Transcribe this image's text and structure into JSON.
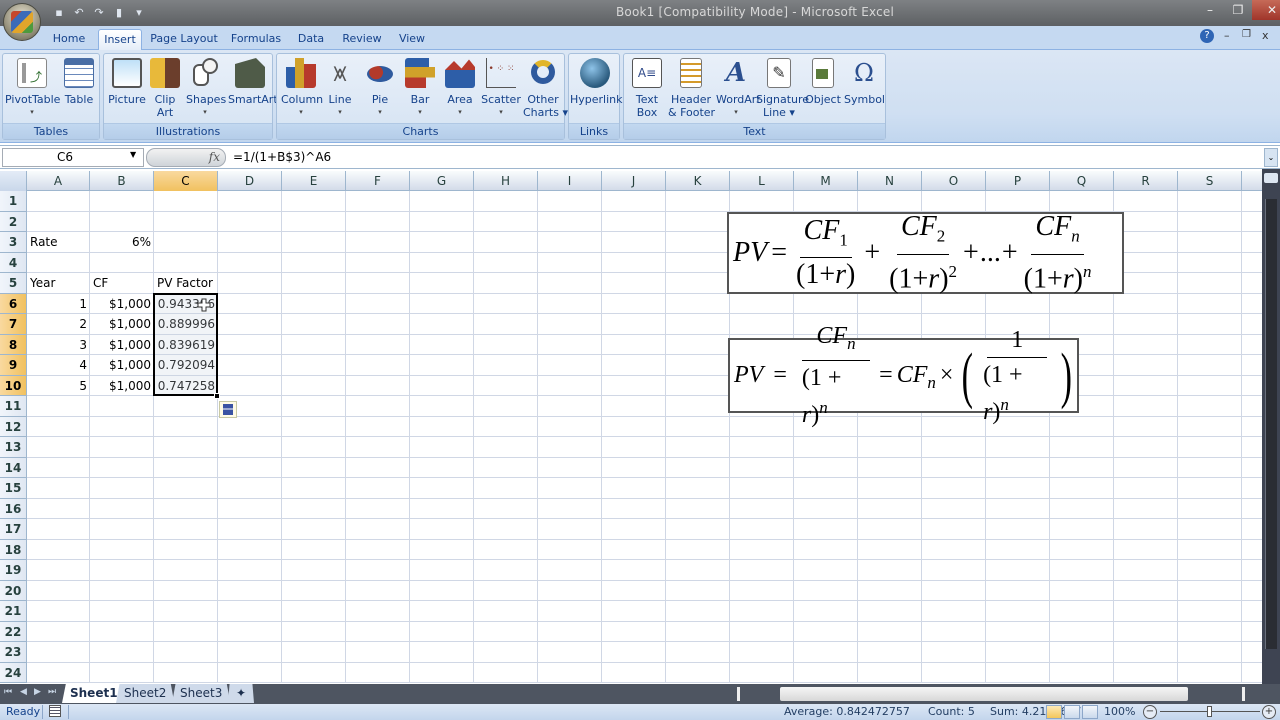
{
  "window": {
    "title": "Book1  [Compatibility Mode] - Microsoft Excel",
    "controls": {
      "minimize": "–",
      "maximize": "❐",
      "close": "✕"
    }
  },
  "quick_access": [
    {
      "name": "save-icon",
      "glyph": "▪"
    },
    {
      "name": "undo-icon",
      "glyph": "↶"
    },
    {
      "name": "redo-icon",
      "glyph": "↷"
    },
    {
      "name": "new-icon",
      "glyph": "▮"
    },
    {
      "name": "customize-icon",
      "glyph": "▾"
    }
  ],
  "tabs": [
    {
      "label": "Home"
    },
    {
      "label": "Insert",
      "active": true
    },
    {
      "label": "Page Layout"
    },
    {
      "label": "Formulas"
    },
    {
      "label": "Data"
    },
    {
      "label": "Review"
    },
    {
      "label": "View"
    }
  ],
  "ribbon_controls": {
    "help": "?",
    "minimize": "–",
    "restore": "❐",
    "close": "x"
  },
  "ribbon": {
    "groups": [
      {
        "label": "Tables",
        "buttons": [
          {
            "label": "PivotTable",
            "dropdown": true
          },
          {
            "label": "Table"
          }
        ]
      },
      {
        "label": "Illustrations",
        "buttons": [
          {
            "label": "Picture"
          },
          {
            "label": "Clip",
            "label2": "Art"
          },
          {
            "label": "Shapes",
            "dropdown": true
          },
          {
            "label": "SmartArt"
          }
        ]
      },
      {
        "label": "Charts",
        "buttons": [
          {
            "label": "Column",
            "dropdown": true
          },
          {
            "label": "Line",
            "dropdown": true
          },
          {
            "label": "Pie",
            "dropdown": true
          },
          {
            "label": "Bar",
            "dropdown": true
          },
          {
            "label": "Area",
            "dropdown": true
          },
          {
            "label": "Scatter",
            "dropdown": true
          },
          {
            "label": "Other",
            "label2": "Charts ▾"
          }
        ]
      },
      {
        "label": "Links",
        "buttons": [
          {
            "label": "Hyperlink"
          }
        ]
      },
      {
        "label": "Text",
        "buttons": [
          {
            "label": "Text",
            "label2": "Box"
          },
          {
            "label": "Header",
            "label2": "& Footer"
          },
          {
            "label": "WordArt",
            "dropdown": true
          },
          {
            "label": "Signature",
            "label2": "Line ▾"
          },
          {
            "label": "Object"
          },
          {
            "label": "Symbol"
          }
        ]
      }
    ]
  },
  "formula_bar": {
    "name_box": "C6",
    "formula": "=1/(1+B$3)^A6",
    "fx": "fx"
  },
  "columns": [
    "A",
    "B",
    "C",
    "D",
    "E",
    "F",
    "G",
    "H",
    "I",
    "J",
    "K",
    "L",
    "M",
    "N",
    "O",
    "P",
    "Q",
    "R",
    "S"
  ],
  "rows": [
    "1",
    "2",
    "3",
    "4",
    "5",
    "6",
    "7",
    "8",
    "9",
    "10",
    "11",
    "12",
    "13",
    "14",
    "15",
    "16",
    "17",
    "18",
    "19",
    "20",
    "21",
    "22",
    "23",
    "24"
  ],
  "selected_cell": "C6",
  "selected_range": "C6:C10",
  "cells": {
    "A3": "Rate",
    "B3": "6%",
    "A5": "Year",
    "B5": "CF",
    "C5": "PV Factor",
    "A6": "1",
    "B6": "$1,000",
    "C6": "0.943396",
    "A7": "2",
    "B7": "$1,000",
    "C7": "0.889996",
    "A8": "3",
    "B8": "$1,000",
    "C8": "0.839619",
    "A9": "4",
    "B9": "$1,000",
    "C9": "0.792094",
    "A10": "5",
    "B10": "$1,000",
    "C10": "0.747258"
  },
  "equations": {
    "eq1": {
      "lhs": "PV",
      "eq": "=",
      "cf": "CF",
      "sub1": "1",
      "sub2": "2",
      "subn": "n",
      "den": "(1+r)",
      "exp2": "2",
      "expn": "n",
      "plus": "+",
      "ellipsis": "...",
      "one_plus": "(1+",
      "r": "r",
      "close": ")"
    },
    "eq2": {
      "lhs": "PV",
      "eq": "=",
      "cf": "CF",
      "subn": "n",
      "times": "×",
      "one": "1",
      "expn": "n",
      "den_open": "(1 + ",
      "r": "r",
      "den_close": ")"
    }
  },
  "sheet_tabs": [
    {
      "label": "Sheet1",
      "active": true
    },
    {
      "label": "Sheet2"
    },
    {
      "label": "Sheet3"
    }
  ],
  "sheet_nav": {
    "first": "⏮",
    "prev": "◀",
    "next": "▶",
    "last": "⏭"
  },
  "status_bar": {
    "mode": "Ready",
    "average": "Average: 0.842472757",
    "count": "Count: 5",
    "sum": "Sum: 4.212363786",
    "zoom": "100%",
    "zoom_level_percent": 100
  }
}
